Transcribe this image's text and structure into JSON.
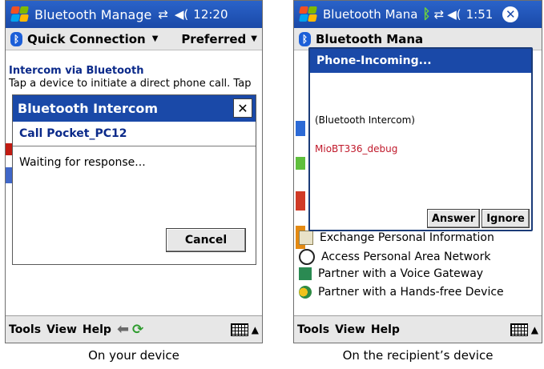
{
  "left_device": {
    "title": "Bluetooth Manage",
    "time": "12:20",
    "menu": {
      "left": "Quick Connection",
      "right": "Preferred"
    },
    "header": "Intercom via Bluetooth",
    "description": "Tap a device to initiate a direct phone call. Tap",
    "dialog": {
      "title": "Bluetooth Intercom",
      "subtitle": "Call Pocket_PC12",
      "message": "Waiting for response...",
      "cancel_label": "Cancel"
    },
    "bottom_menu": [
      "Tools",
      "View",
      "Help"
    ],
    "caption": "On your device"
  },
  "right_device": {
    "title": "Bluetooth Mana",
    "time": "1:51",
    "under_text": "Bluetooth Mana",
    "popup": {
      "title": "Phone-Incoming...",
      "caller": "(Bluetooth Intercom)",
      "device": "MioBT336_debug",
      "answer_label": "Answer",
      "ignore_label": "Ignore"
    },
    "list_items": [
      {
        "label": "Exchange Personal Information",
        "icon": "exchange-icon"
      },
      {
        "label": "Access Personal Area Network",
        "icon": "network-icon"
      },
      {
        "label": "Partner with a Voice Gateway",
        "icon": "gateway-icon"
      },
      {
        "label": "Partner with a Hands-free Device",
        "icon": "handsfree-icon"
      }
    ],
    "bottom_menu": [
      "Tools",
      "View",
      "Help"
    ],
    "caption": "On the recipient’s device"
  },
  "colors": {
    "title_blue": "#1a49a8",
    "header_text": "#0b2a8a",
    "device_red": "#c0192b"
  }
}
